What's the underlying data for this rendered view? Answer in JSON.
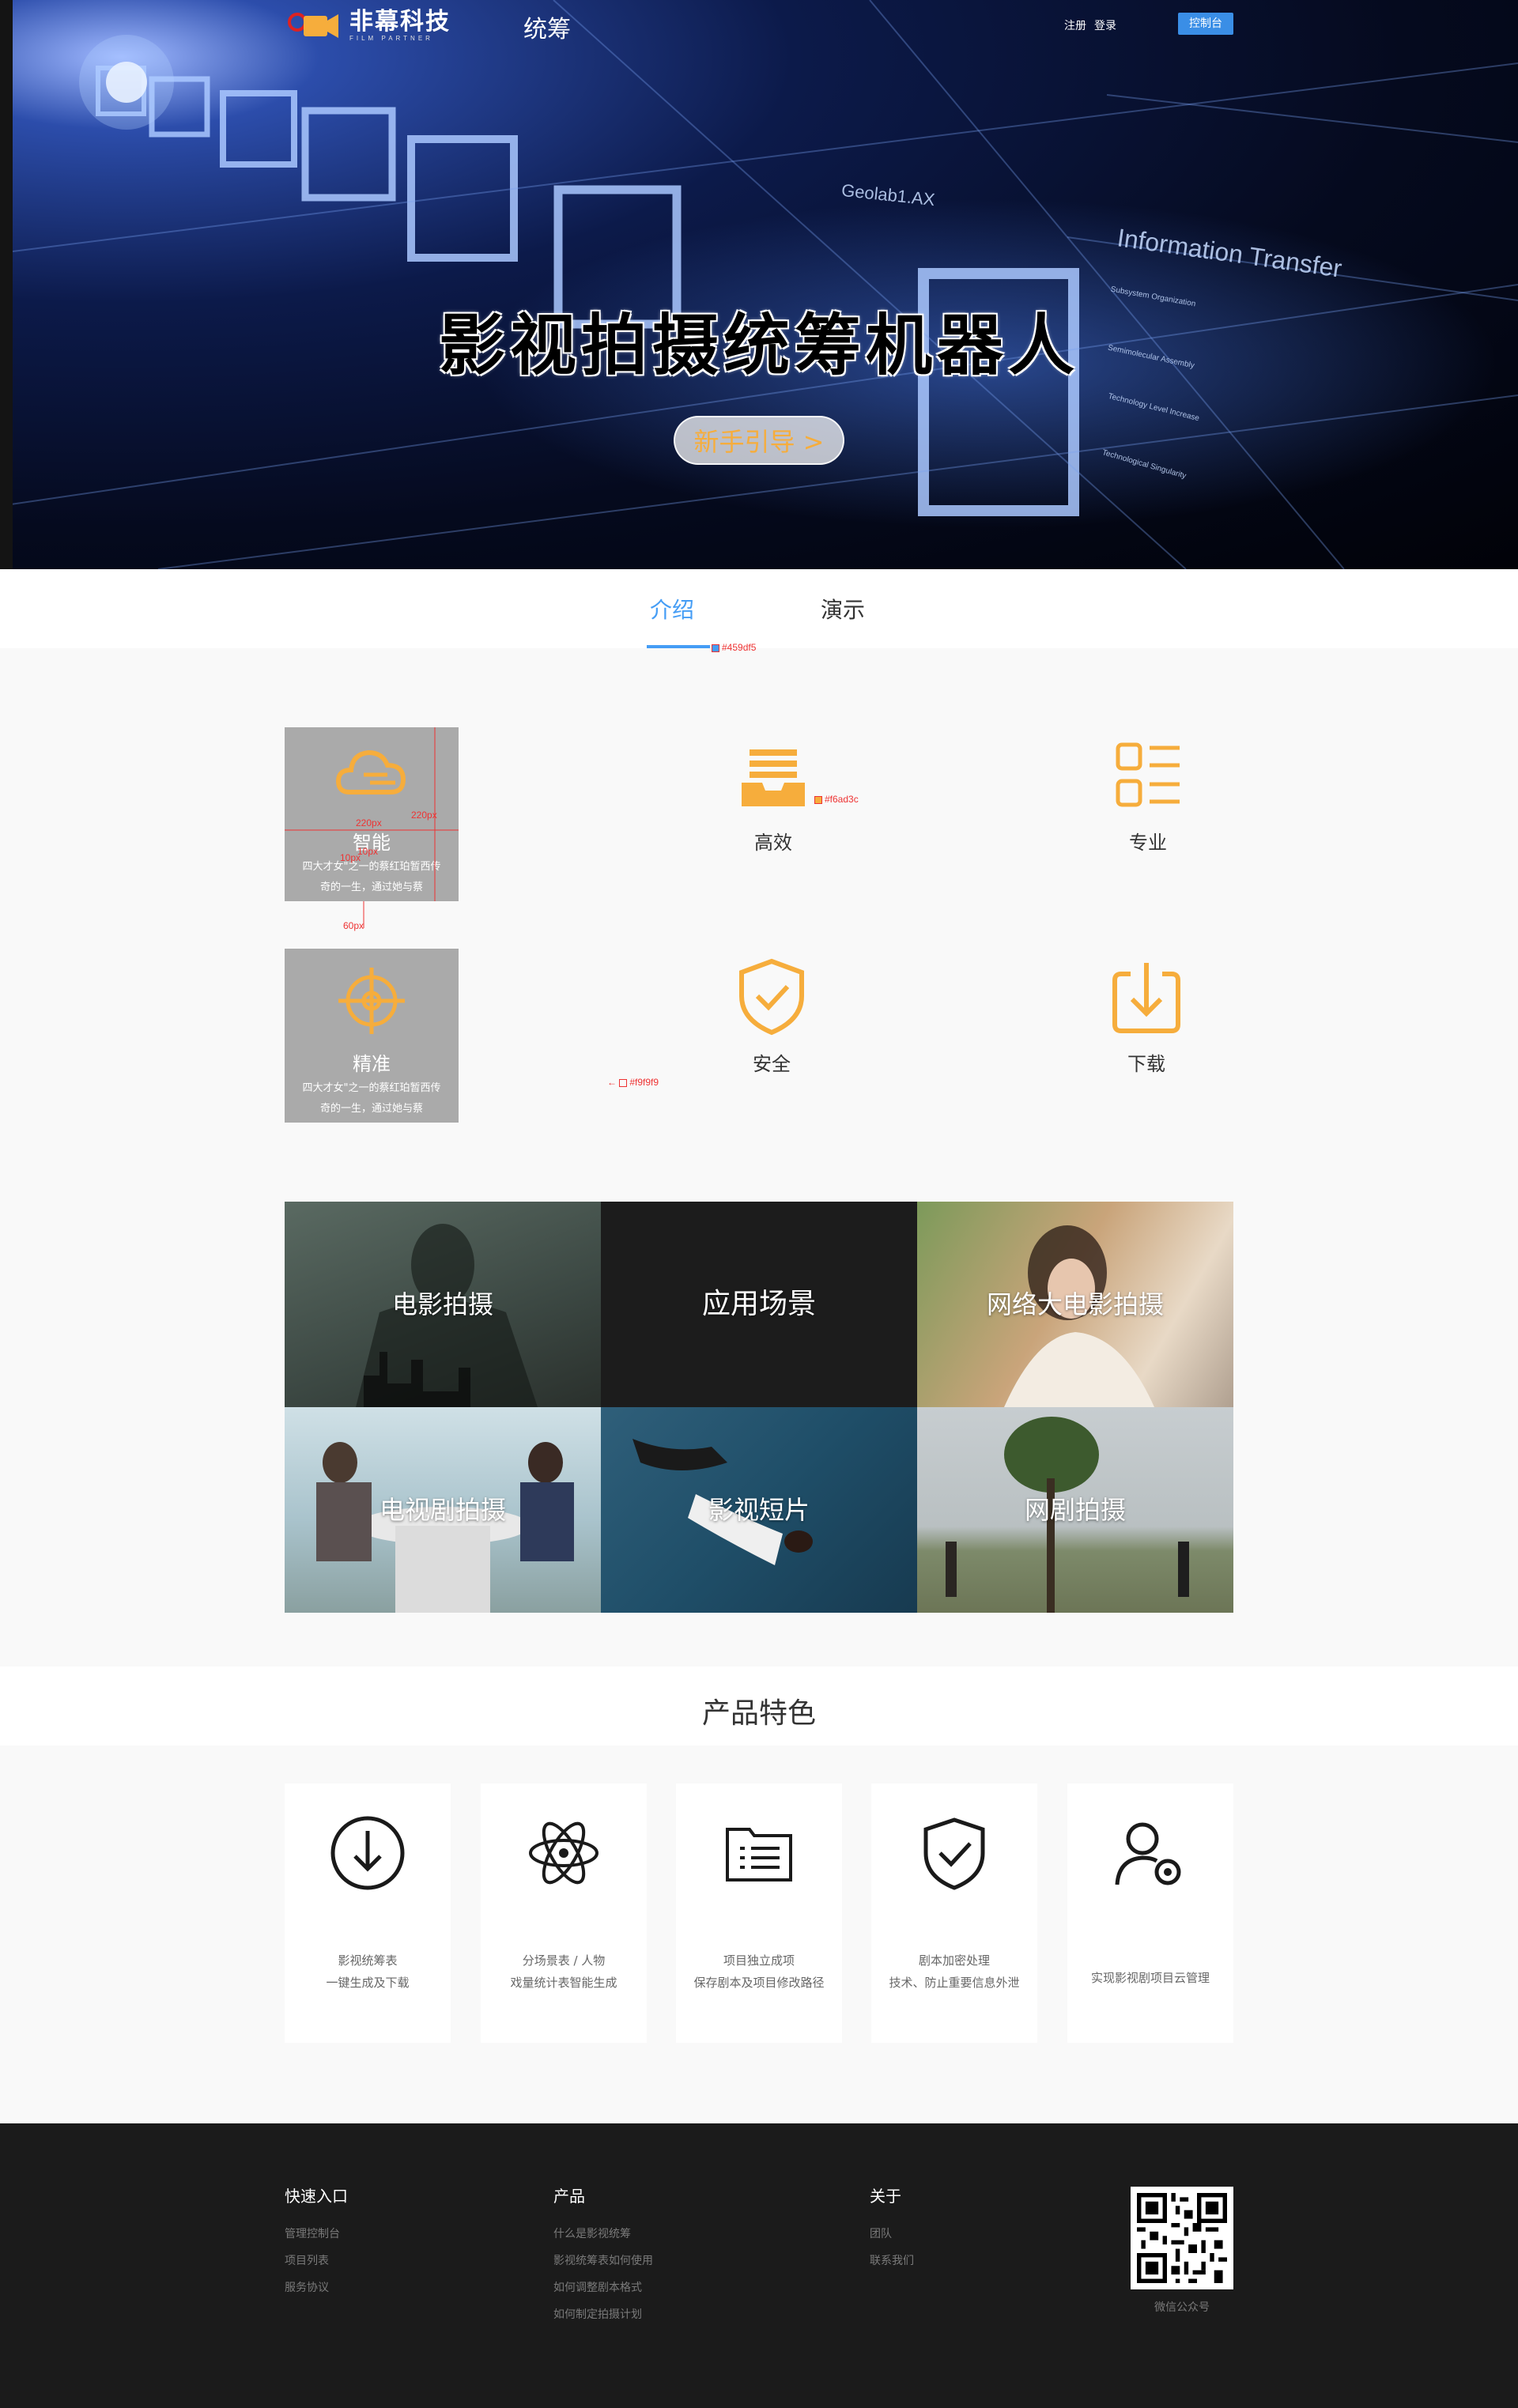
{
  "nav": {
    "logo_cn": "非幕科技",
    "logo_en": "FILM PARTNER",
    "title": "统筹",
    "register": "注册",
    "login": "登录",
    "console": "控制台"
  },
  "hero": {
    "title": "影视拍摄统筹机器人",
    "guide_button": "新手引导 >",
    "bg_text_1": "Geolab1.AX",
    "bg_text_2": "Information Transfer",
    "bg_text_3": "Subsystem Organization",
    "bg_text_4": "Semimolecular Assembly",
    "bg_text_5": "Technology Level Increase",
    "bg_text_6": "Technological Singularity"
  },
  "tabs": [
    {
      "label": "介绍"
    },
    {
      "label": "演示"
    }
  ],
  "annotations": {
    "tab_color": "#459df5",
    "w220": "220px",
    "h220": "220px",
    "gap10a": "10px",
    "gap10b": "10px",
    "gap60": "60px",
    "icon_color": "#f6ad3c",
    "bg_color": "#f9f9f9"
  },
  "features": [
    {
      "title": "智能",
      "desc": "四大才女\"之一的蔡红珀暂西传奇的一生，通过她与蔡",
      "icon": "cloud-icon"
    },
    {
      "title": "高效",
      "icon": "inbox-tray-icon"
    },
    {
      "title": "专业",
      "icon": "list-icon"
    },
    {
      "title": "精准",
      "desc": "四大才女\"之一的蔡红珀暂西传奇的一生，通过她与蔡",
      "icon": "crosshair-icon"
    },
    {
      "title": "安全",
      "icon": "shield-check-icon"
    },
    {
      "title": "下载",
      "icon": "download-icon"
    }
  ],
  "scenes": [
    {
      "label": "电影拍摄"
    },
    {
      "label": "应用场景"
    },
    {
      "label": "网络大电影拍摄"
    },
    {
      "label": "电视剧拍摄"
    },
    {
      "label": "影视短片"
    },
    {
      "label": "网剧拍摄"
    }
  ],
  "product_features": {
    "title": "产品特色",
    "cards": [
      {
        "line1": "影视统筹表",
        "line2": "一键生成及下载",
        "icon": "download-circle-icon"
      },
      {
        "line1": "分场景表 / 人物",
        "line2": "戏量统计表智能生成",
        "icon": "atom-icon"
      },
      {
        "line1": "项目独立成项",
        "line2": "保存剧本及项目修改路径",
        "icon": "folder-list-icon"
      },
      {
        "line1": "剧本加密处理",
        "line2": "技术、防止重要信息外泄",
        "icon": "shield-check-icon"
      },
      {
        "line1": "实现影视剧项目云管理",
        "line2": "",
        "icon": "user-gear-icon"
      }
    ]
  },
  "footer": {
    "quick": {
      "head": "快速入口",
      "links": [
        "管理控制台",
        "项目列表",
        "服务协议"
      ]
    },
    "product": {
      "head": "产品",
      "links": [
        "什么是影视统筹",
        "影视统筹表如何使用",
        "如何调整剧本格式",
        "如何制定拍摄计划"
      ]
    },
    "about": {
      "head": "关于",
      "links": [
        "团队",
        "联系我们"
      ]
    },
    "qr_caption": "微信公众号"
  },
  "colors": {
    "accent": "#459df5",
    "icon_orange": "#f6ad3c",
    "page_bg": "#f9f9f9",
    "footer_bg": "#1b1b1b"
  }
}
